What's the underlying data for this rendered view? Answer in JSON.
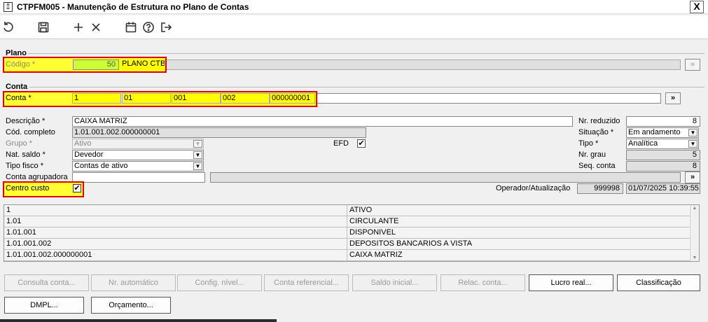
{
  "window": {
    "title": "CTPFM005 - Manutenção de Estrutura no Plano de Contas",
    "close": "X"
  },
  "toolbar": [
    "undo-icon",
    "save-icon",
    "add-icon",
    "delete-icon",
    "calendar-icon",
    "help-icon",
    "exit-icon"
  ],
  "plano": {
    "group": "Plano",
    "codigo_label": "Código *",
    "codigo_value": "50",
    "nome": "PLANO CTB",
    "more": "»"
  },
  "conta": {
    "group": "Conta",
    "label": "Conta *",
    "seg1": "1",
    "seg2": "01",
    "seg3": "001",
    "seg4": "002",
    "seg5": "000000001",
    "more": "»"
  },
  "form": {
    "descricao_label": "Descrição *",
    "descricao": "CAIXA MATRIZ",
    "cod_completo_label": "Cód. completo",
    "cod_completo": "1.01.001.002.000000001",
    "grupo_label": "Grupo *",
    "grupo": "Ativo",
    "efd_label": "EFD",
    "efd_checked": "✔",
    "nat_saldo_label": "Nat. saldo *",
    "nat_saldo": "Devedor",
    "tipo_fisco_label": "Tipo fisco *",
    "tipo_fisco": "Contas de ativo",
    "conta_agrup_label": "Conta agrupadora",
    "conta_agrup": "",
    "conta_agrup_more": "»",
    "centro_custo_label": "Centro custo",
    "centro_custo_checked": "✔",
    "nr_reduzido_label": "Nr. reduzido",
    "nr_reduzido": "8",
    "situacao_label": "Situação *",
    "situacao": "Em andamento",
    "tipo_label": "Tipo *",
    "tipo": "Analítica",
    "nr_grau_label": "Nr. grau",
    "nr_grau": "5",
    "seq_conta_label": "Seq. conta",
    "seq_conta": "8",
    "operador_label": "Operador/Atualização",
    "operador": "999998",
    "atualizacao": "01/07/2025 10:39:55"
  },
  "grid": [
    {
      "code": "1",
      "name": "ATIVO"
    },
    {
      "code": "1.01",
      "name": "CIRCULANTE"
    },
    {
      "code": "1.01.001",
      "name": "DISPONIVEL"
    },
    {
      "code": "1.01.001.002",
      "name": "DEPOSITOS BANCARIOS A VISTA"
    },
    {
      "code": "1.01.001.002.000000001",
      "name": "CAIXA MATRIZ"
    }
  ],
  "buttons": {
    "consulta": "Consulta conta...",
    "nr_auto": "Nr. automático",
    "config": "Config. nível...",
    "referencial": "Conta referencial...",
    "saldo": "Saldo inicial...",
    "relac": "Relac. conta...",
    "lucro": "Lucro real...",
    "classif": "Classificação",
    "dmpl": "DMPL...",
    "orcamento": "Orçamento..."
  }
}
